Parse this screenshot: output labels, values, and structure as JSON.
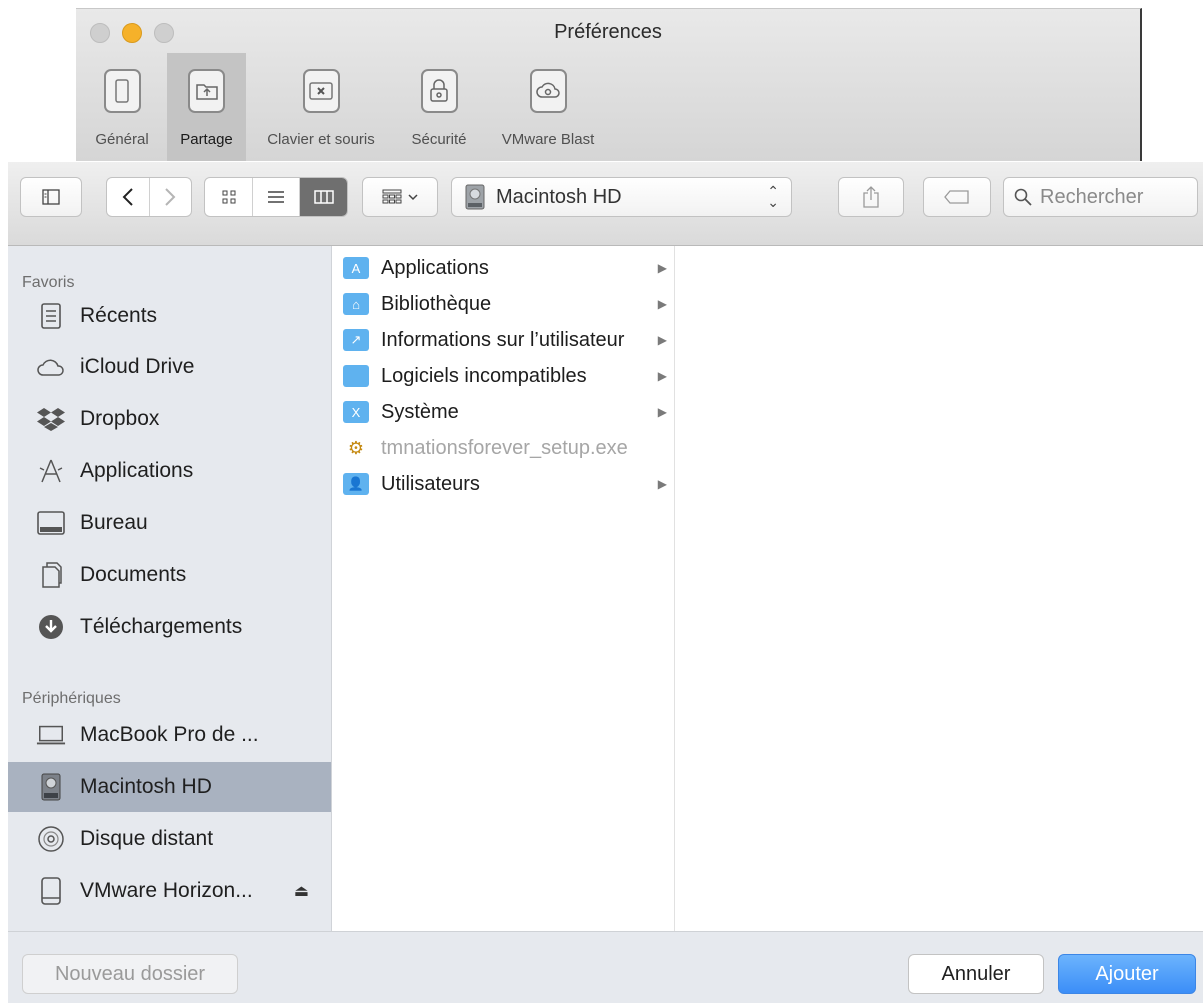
{
  "prefs": {
    "title": "Préférences",
    "tabs": [
      {
        "label": "Général",
        "icon": "phone-icon"
      },
      {
        "label": "Partage",
        "icon": "shared-folder-icon",
        "selected": true
      },
      {
        "label": "Clavier et souris",
        "icon": "keyboard-icon"
      },
      {
        "label": "Sécurité",
        "icon": "lock-icon"
      },
      {
        "label": "VMware Blast",
        "icon": "cloud-icon"
      }
    ]
  },
  "toolbar": {
    "location": "Macintosh HD",
    "search_placeholder": "Rechercher",
    "view_mode": "columns"
  },
  "sidebar": {
    "favorites_header": "Favoris",
    "favorites": [
      {
        "label": "Récents",
        "icon": "recents-icon"
      },
      {
        "label": "iCloud Drive",
        "icon": "cloud-icon"
      },
      {
        "label": "Dropbox",
        "icon": "dropbox-icon"
      },
      {
        "label": "Applications",
        "icon": "applications-icon"
      },
      {
        "label": "Bureau",
        "icon": "desktop-icon"
      },
      {
        "label": "Documents",
        "icon": "documents-icon"
      },
      {
        "label": "Téléchargements",
        "icon": "download-icon"
      }
    ],
    "devices_header": "Périphériques",
    "devices": [
      {
        "label": "MacBook Pro de ...",
        "icon": "laptop-icon"
      },
      {
        "label": "Macintosh HD",
        "icon": "hard-drive-icon",
        "selected": true
      },
      {
        "label": "Disque distant",
        "icon": "disc-icon"
      },
      {
        "label": "VMware Horizon...",
        "icon": "external-drive-icon",
        "eject": true
      }
    ]
  },
  "files": [
    {
      "name": "Applications",
      "kind": "folder",
      "has_children": true
    },
    {
      "name": "Bibliothèque",
      "kind": "folder",
      "has_children": true
    },
    {
      "name": "Informations sur l’utilisateur",
      "kind": "alias-folder",
      "has_children": true
    },
    {
      "name": "Logiciels incompatibles",
      "kind": "folder",
      "has_children": true
    },
    {
      "name": "Système",
      "kind": "folder",
      "has_children": true
    },
    {
      "name": "tmnationsforever_setup.exe",
      "kind": "file",
      "dimmed": true,
      "has_children": false
    },
    {
      "name": "Utilisateurs",
      "kind": "folder",
      "has_children": true
    }
  ],
  "footer": {
    "new_folder": "Nouveau dossier",
    "cancel": "Annuler",
    "add": "Ajouter"
  },
  "colors": {
    "accent": "#3b8ef7",
    "sidebar_selected": "#a9b2c0",
    "folder": "#5fb2ef"
  }
}
